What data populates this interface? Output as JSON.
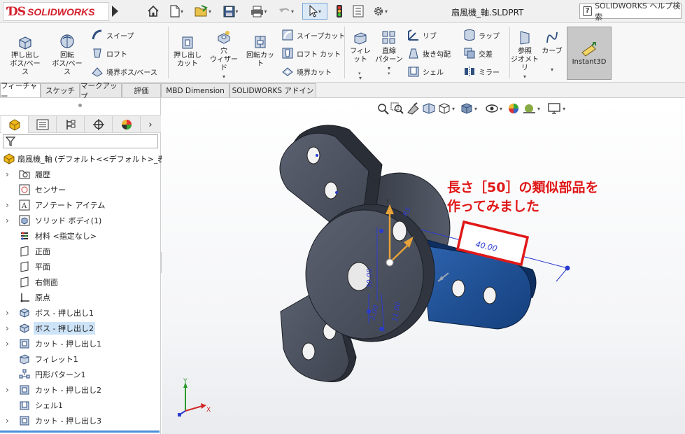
{
  "app": {
    "logo_text": "SOLIDWORKS",
    "document_title": "扇風機_軸.SLDPRT",
    "help_search": "SOLIDWORKS ヘルプ検索"
  },
  "ribbon": {
    "extrude_boss": "押し出し\nボス/ベース",
    "revolve_boss": "回転\nボス/ベース",
    "sweep": "スイープ",
    "loft": "ロフト",
    "boundary_boss": "境界ボス/ベース",
    "extrude_cut": "押し出し\nカット",
    "hole_wizard": "穴\nウィザード",
    "revolve_cut": "回転カット",
    "sweep_cut": "スイープカット",
    "loft_cut": "ロフト カット",
    "boundary_cut": "境界カット",
    "fillet": "フィレット",
    "linear_pattern": "直線\nパターン",
    "rib": "リブ",
    "draft": "抜き勾配",
    "shell": "シェル",
    "wrap": "ラップ",
    "intersect": "交差",
    "mirror": "ミラー",
    "ref_geometry": "参照\nジオメトリ",
    "curves": "カーブ",
    "instant3d": "Instant3D"
  },
  "tabs": [
    "フィーチャー",
    "スケッチ",
    "マークアップ",
    "評価",
    "MBD Dimension",
    "SOLIDWORKS アドイン"
  ],
  "tree": {
    "root": "扇風機_軸 (デフォルト<<デフォルト>_表示状",
    "items": [
      {
        "label": "履歴",
        "expand": true
      },
      {
        "label": "センサー",
        "expand": false
      },
      {
        "label": "アノテート アイテム",
        "expand": true
      },
      {
        "label": "ソリッド ボディ(1)",
        "expand": true
      },
      {
        "label": "材料 <指定なし>",
        "expand": false
      },
      {
        "label": "正面",
        "expand": false
      },
      {
        "label": "平面",
        "expand": false
      },
      {
        "label": "右側面",
        "expand": false
      },
      {
        "label": "原点",
        "expand": false
      },
      {
        "label": "ボス - 押し出し1",
        "expand": true
      },
      {
        "label": "ボス - 押し出し2",
        "expand": true
      },
      {
        "label": "カット - 押し出し1",
        "expand": true
      },
      {
        "label": "フィレット1",
        "expand": false
      },
      {
        "label": "円形パターン1",
        "expand": false
      },
      {
        "label": "カット - 押し出し2",
        "expand": true
      },
      {
        "label": "シェル1",
        "expand": false
      },
      {
        "label": "カット - 押し出し3",
        "expand": true
      }
    ]
  },
  "viewport": {
    "annotation_line1": "長さ［50］の類似部品を",
    "annotation_line2": "作ってみました",
    "dim_length": "40.00",
    "dim_a": "30.00",
    "dim_b": "2.00",
    "dim_c": "11.00",
    "dim_d": "R5",
    "triad_y": "Y",
    "triad_x": "X",
    "drag_x": "X",
    "drag_y": "Y"
  },
  "colors": {
    "accent_red": "#e01818",
    "part_gray": "#4a4f5c",
    "part_blue": "#1c4f94",
    "selection_blue": "#cde3f7"
  }
}
